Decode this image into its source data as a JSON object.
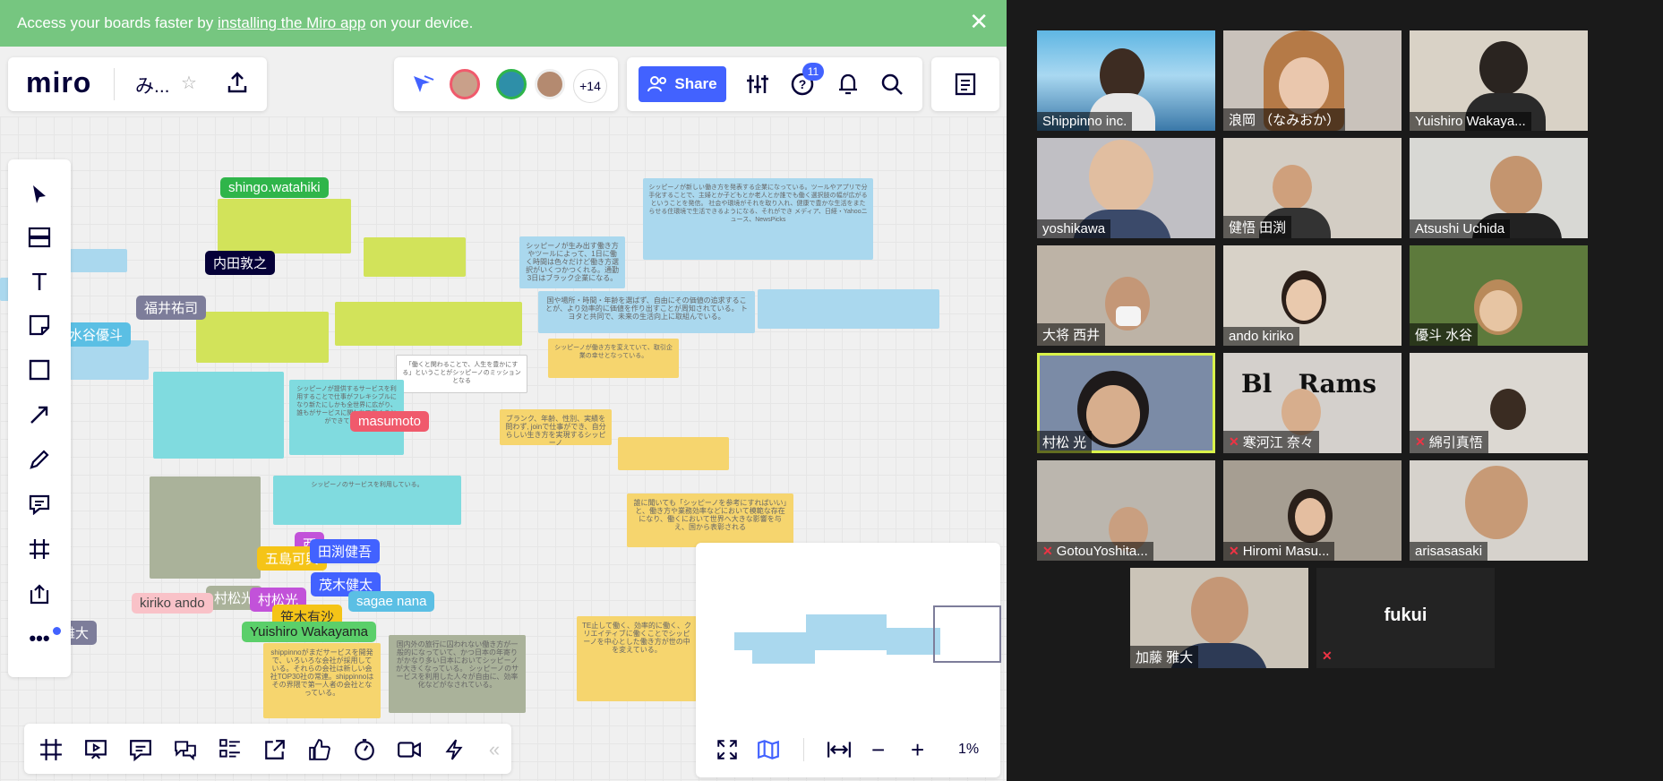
{
  "banner": {
    "prefix": "Access your boards faster by ",
    "link": "installing the Miro app",
    "suffix": " on your device."
  },
  "header": {
    "logo": "miro",
    "board_title": "み...",
    "avatar_badge": "+14",
    "share_label": "Share",
    "help_badge": "11"
  },
  "canvas": {
    "cursor_labels": [
      {
        "name": "shingo.watahiki",
        "color": "#2fb54a"
      },
      {
        "name": "内田敦之",
        "color": "#050038"
      },
      {
        "name": "福井祐司",
        "color": "#7d7d9a"
      },
      {
        "name": "水谷優斗",
        "color": "#5bbfe4"
      },
      {
        "name": "masumoto",
        "color": "#f05a6c"
      },
      {
        "name": "五島可興",
        "color": "#f5c417"
      },
      {
        "name": "田渕健吾",
        "color": "#4262ff"
      },
      {
        "name": "茂木健太",
        "color": "#4262ff"
      },
      {
        "name": "村松光",
        "color": "#c252d9"
      },
      {
        "name": "sagae nana",
        "color": "#5bbfe4"
      },
      {
        "name": "kiriko ando",
        "color": "#f9c2c8"
      },
      {
        "name": "笹木有沙",
        "color": "#f5c417"
      },
      {
        "name": "Yuishiro Wakayama",
        "color": "#5bcf6a"
      },
      {
        "name": "村松光",
        "color": "#aab29a"
      },
      {
        "name": "雅大",
        "color": "#7d7d9a"
      },
      {
        "name": "西",
        "color": "#c252d9"
      }
    ],
    "stickies": {
      "s1": "シッピーノが新しい働き方を発表する企業になっている。ツールやアプリで分手化することで、主婦とか子どもとか老人とか誰でも働く選択肢の幅が広がるということを発信。 社会や環境がそれを取り入れ、健康で豊かな生活をまたらせる住環境で生活できるようになる、それができ  メディア、日経・Yahooニュース、NewsPicks",
      "s2": "シッピーノが生み出す働き方やツールによって、1日に働く時間は色々だけど働き方選択がいくつかつくれる。通勤3日はブラック企業になる。",
      "s3": "国や場所・時間・年齢を選ばず、自由にその価値の追求することが、より効率的に価値を作り出すことが周知されている。 トヨタと共同で、未来の生活向上に取組んでいる。",
      "s4": "ブランク、年齢、性別、実績を問わず, joinで仕事ができ、自分らしい生き方を実現するシッピーノ",
      "s5": "誰に聞いても「シッピーノを参考にすればいい」と、働き方や業務効率などにおいて模範な存在になり、働くにおいて世界へ大きな影響を与え、国から表彰される",
      "s6": "shippinnoがまだサービスを開発で、いろいろな会社が採用している。それらの会社は新しい会社TOP30社の常連。shippinnoはその界隈で第一人者の会社となっている。",
      "s7": "シッピーノが提供するサービスを利用することで仕事がフレキシブルになり新たにしかも全世界に広がり、誰もがサービスに関われて働くことができている。",
      "s8": "「働くと関わることで、人生を豊かにする」ということがシッピーノのミッションとなる",
      "s9": "国内外の旅行に囚われない働き方が一般的になっていて、かつ日本の年寄りがかなり多い日本においてシッピーノが大きくなっている。 シッピーノのサービスを利用した人々が自由に、効率化などがなされている。",
      "s10": "TE止して働く、効率的に働く、クリエイティブに働くことでシッピーノを中心とした働き方が世の中を変えている。",
      "s11": "シッピーノが働き方を変えていて、取引企業の幸せとなっている。",
      "s12": "シッピーノのサービスを利用している。"
    }
  },
  "bottom": {
    "zoom": "1%"
  },
  "participants": [
    {
      "name": "Shippinno inc.",
      "muted": false
    },
    {
      "name": "浪岡 （なみおか）",
      "muted": false
    },
    {
      "name": "Yuishiro Wakaya...",
      "muted": false
    },
    {
      "name": "yoshikawa",
      "muted": false
    },
    {
      "name": "健悟 田渕",
      "muted": false
    },
    {
      "name": "Atsushi Uchida",
      "muted": false
    },
    {
      "name": "大将 西井",
      "muted": false
    },
    {
      "name": "ando kiriko",
      "muted": false
    },
    {
      "name": "優斗 水谷",
      "muted": false
    },
    {
      "name": "村松 光",
      "muted": false
    },
    {
      "name": "寒河江 奈々",
      "muted": true
    },
    {
      "name": "綿引真悟",
      "muted": true
    },
    {
      "name": "GotouYoshita...",
      "muted": true
    },
    {
      "name": "Hiromi Masu...",
      "muted": true
    },
    {
      "name": "arisasasaki",
      "muted": false
    },
    {
      "name": "加藤 雅大",
      "muted": false
    },
    {
      "name": "fukui",
      "muted": true
    }
  ],
  "colors": {
    "banner": "#76c680",
    "share": "#4262ff",
    "active_speaker": "#d9f24a"
  }
}
